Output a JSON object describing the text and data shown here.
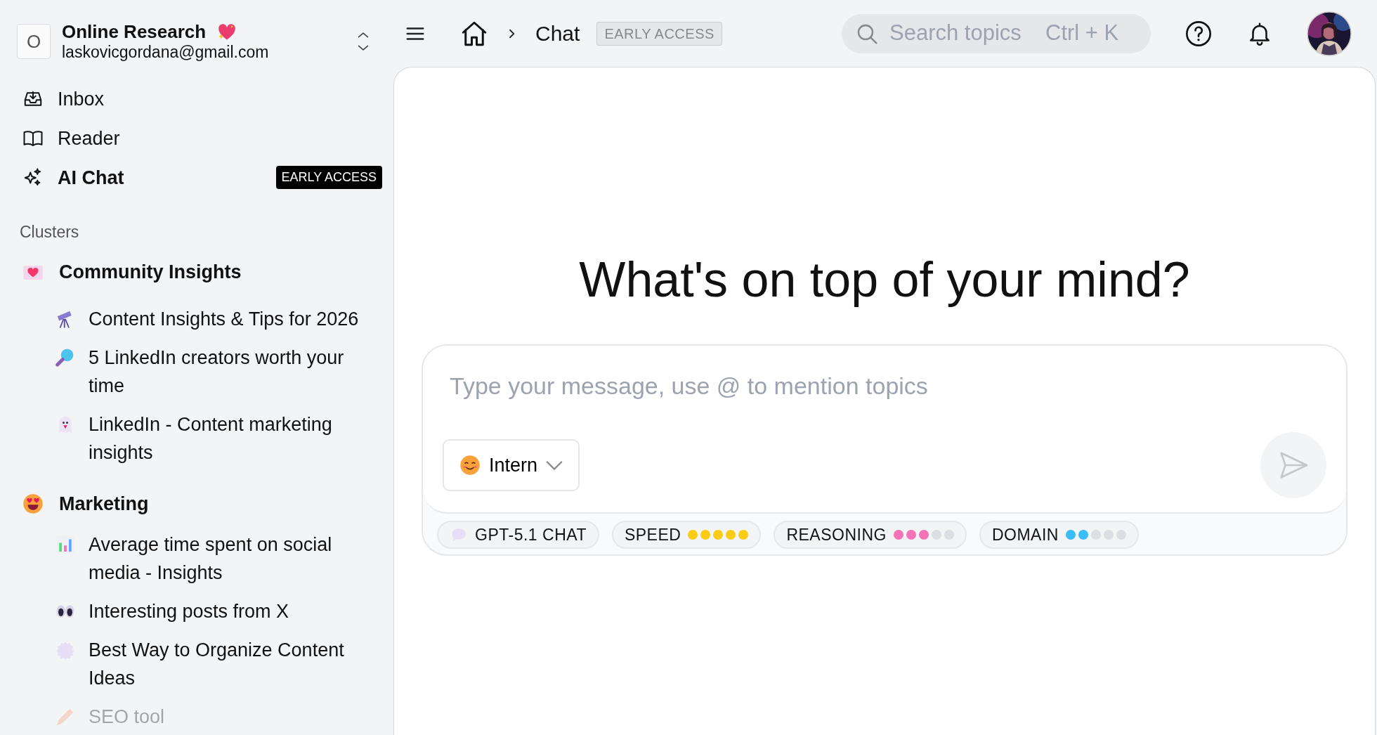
{
  "workspace": {
    "initial": "O",
    "name": "Online Research",
    "email": "laskovicgordana@gmail.com"
  },
  "nav": [
    {
      "label": "Inbox",
      "selected": false
    },
    {
      "label": "Reader",
      "selected": false
    },
    {
      "label": "AI Chat",
      "selected": true,
      "badge": "EARLY ACCESS"
    }
  ],
  "clusters_heading": "Clusters",
  "clusters": [
    {
      "name": "Community Insights",
      "items": [
        {
          "title": "Content Insights & Tips for 2026"
        },
        {
          "title": "5 LinkedIn creators worth your time"
        },
        {
          "title": "LinkedIn - Content marketing insights"
        }
      ]
    },
    {
      "name": "Marketing",
      "items": [
        {
          "title": "Average time spent on social media - Insights"
        },
        {
          "title": "Interesting posts from X"
        },
        {
          "title": "Best Way to Organize Content Ideas"
        },
        {
          "title": "SEO tool"
        }
      ]
    }
  ],
  "breadcrumb": {
    "page": "Chat",
    "badge": "EARLY ACCESS"
  },
  "search": {
    "placeholder": "Search topics",
    "shortcut": "Ctrl + K"
  },
  "heading": "What's on top of your mind?",
  "composer": {
    "placeholder": "Type your message, use @ to mention topics",
    "persona": "Intern"
  },
  "model": "GPT-5.1 CHAT",
  "meters": [
    {
      "label": "SPEED",
      "stars": 5,
      "color": "#facc15"
    },
    {
      "label": "REASONING",
      "stars": 3,
      "color": "#f472b6"
    },
    {
      "label": "DOMAIN",
      "stars": 2,
      "color": "#38bdf8"
    }
  ]
}
